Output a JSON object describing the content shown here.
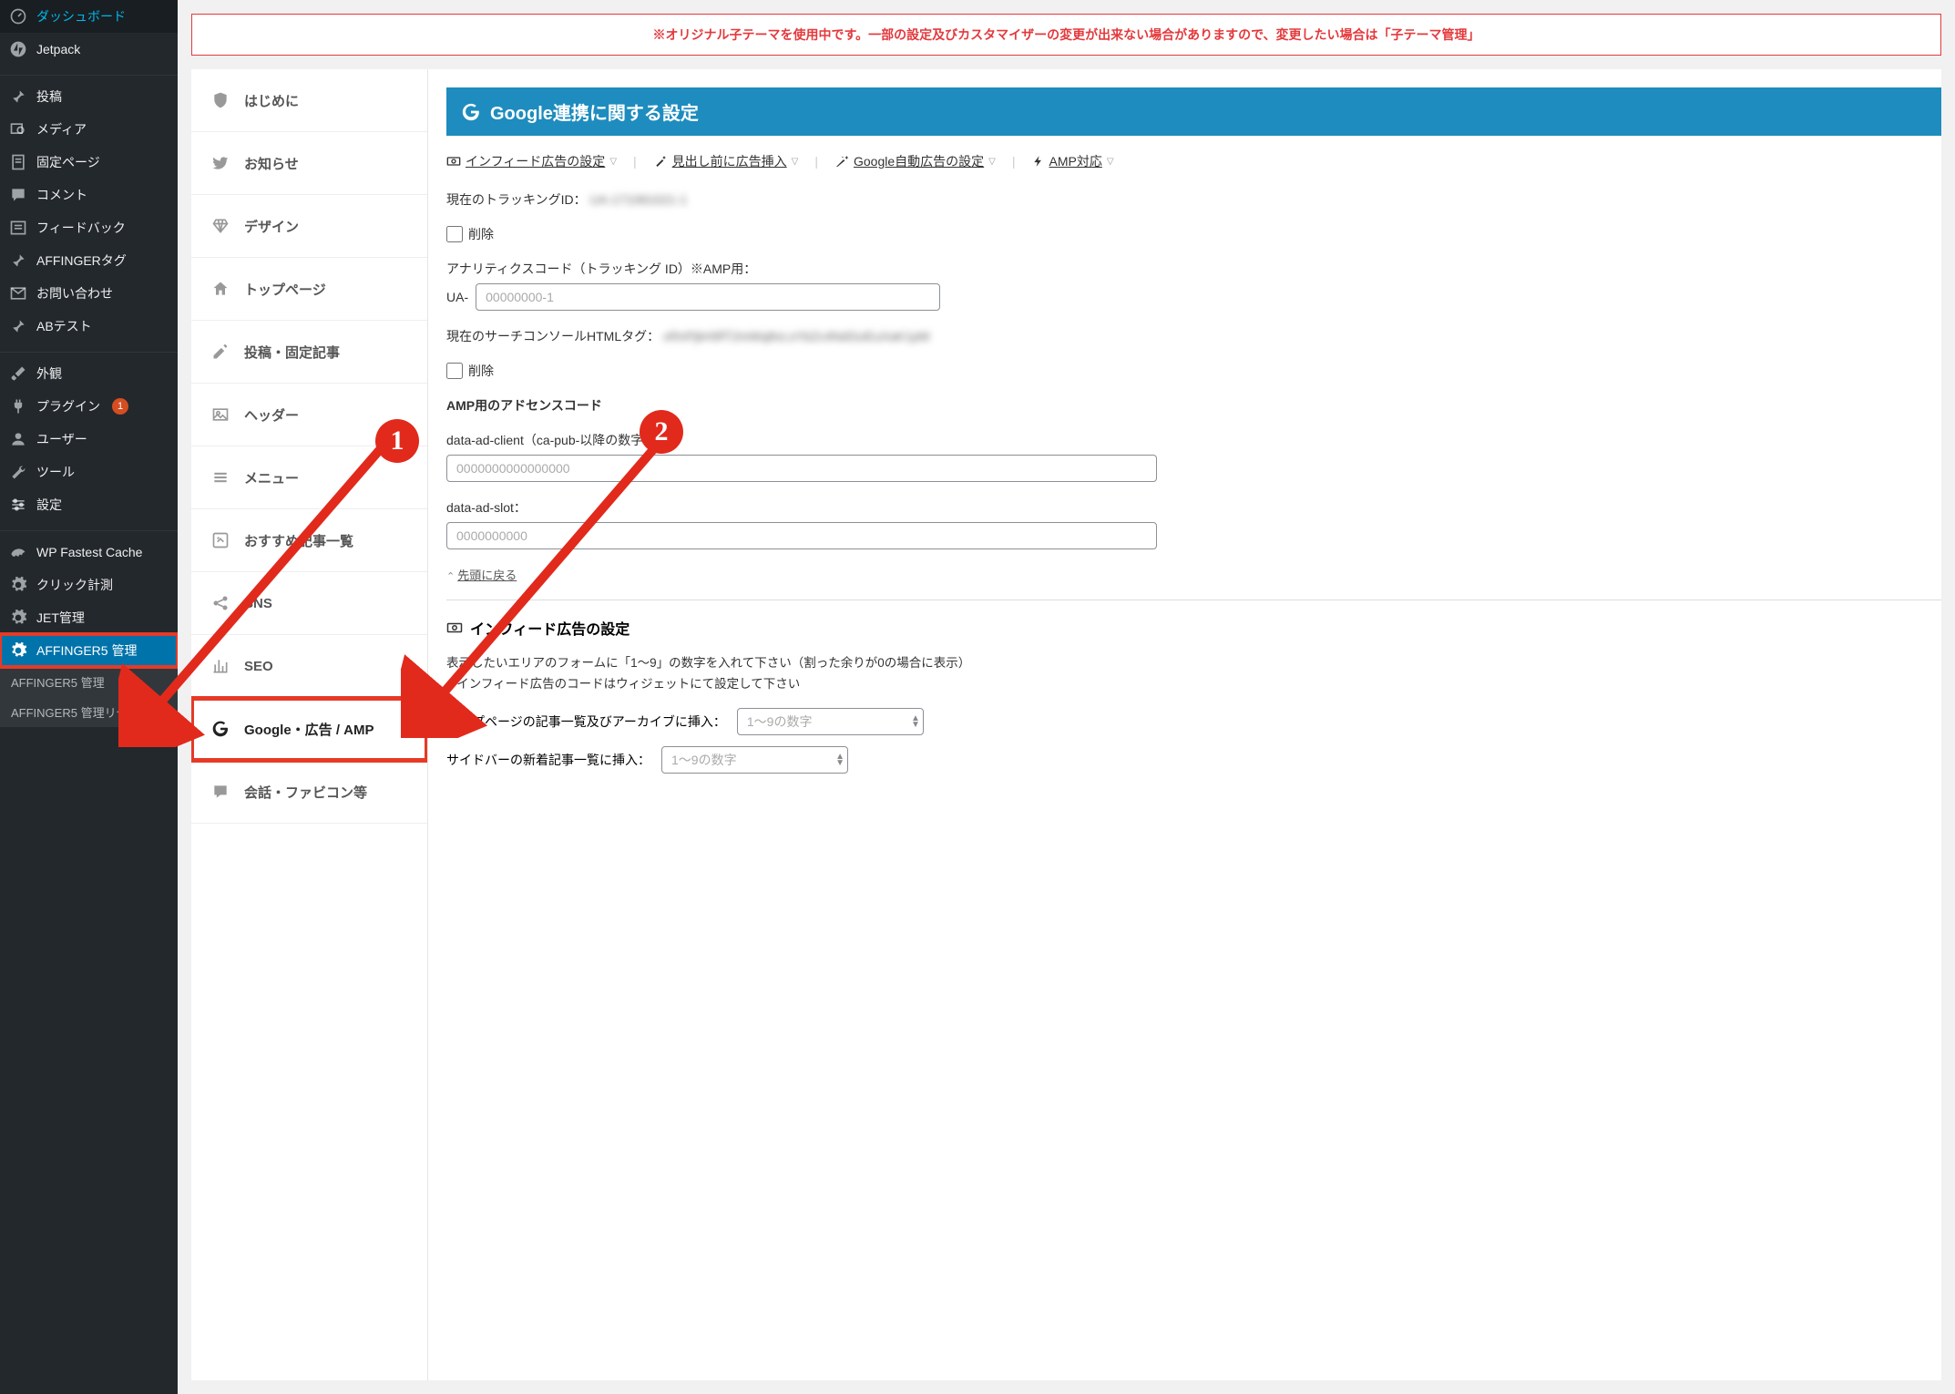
{
  "wp_sidebar": {
    "items": [
      {
        "label": "ダッシュボード",
        "icon": "dashboard"
      },
      {
        "label": "Jetpack",
        "icon": "jetpack"
      },
      {
        "sep": true
      },
      {
        "label": "投稿",
        "icon": "pin"
      },
      {
        "label": "メディア",
        "icon": "media"
      },
      {
        "label": "固定ページ",
        "icon": "page"
      },
      {
        "label": "コメント",
        "icon": "comment"
      },
      {
        "label": "フィードバック",
        "icon": "feedback"
      },
      {
        "label": "AFFINGERタグ",
        "icon": "pin"
      },
      {
        "label": "お問い合わせ",
        "icon": "mail"
      },
      {
        "label": "ABテスト",
        "icon": "pin"
      },
      {
        "sep": true
      },
      {
        "label": "外観",
        "icon": "brush"
      },
      {
        "label": "プラグイン",
        "icon": "plug",
        "badge": "1"
      },
      {
        "label": "ユーザー",
        "icon": "user"
      },
      {
        "label": "ツール",
        "icon": "wrench"
      },
      {
        "label": "設定",
        "icon": "sliders"
      },
      {
        "sep": true
      },
      {
        "label": "WP Fastest Cache",
        "icon": "cheetah"
      },
      {
        "label": "クリック計測",
        "icon": "gear"
      },
      {
        "label": "JET管理",
        "icon": "gear"
      },
      {
        "label": "AFFINGER5 管理",
        "icon": "gear",
        "active": true
      }
    ],
    "subs": [
      {
        "label": "AFFINGER5 管理"
      },
      {
        "label": "AFFINGER5 管理リセット"
      }
    ]
  },
  "warning": "※オリジナル子テーマを使用中です。一部の設定及びカスタマイザーの変更が出来ない場合がありますので、変更したい場合は「子テーマ管理」",
  "settings_nav": [
    {
      "label": "はじめに",
      "icon": "shield"
    },
    {
      "label": "お知らせ",
      "icon": "twitter"
    },
    {
      "label": "デザイン",
      "icon": "diamond"
    },
    {
      "label": "トップページ",
      "icon": "home"
    },
    {
      "label": "投稿・固定記事",
      "icon": "edit"
    },
    {
      "label": "ヘッダー",
      "icon": "image"
    },
    {
      "label": "メニュー",
      "icon": "menu"
    },
    {
      "label": "おすすめ記事一覧",
      "icon": "editbox"
    },
    {
      "label": "SNS",
      "icon": "share"
    },
    {
      "label": "SEO",
      "icon": "chart"
    },
    {
      "label": "Google・広告 / AMP",
      "icon": "google",
      "current": true
    },
    {
      "label": "会話・ファビコン等",
      "icon": "speech"
    }
  ],
  "main": {
    "header": "Google連携に関する設定",
    "quicklinks": [
      {
        "icon": "money",
        "text": "インフィード広告の設定"
      },
      {
        "icon": "wand",
        "text": "見出し前に広告挿入"
      },
      {
        "icon": "wand2",
        "text": "Google自動広告の設定"
      },
      {
        "icon": "bolt",
        "text": "AMP対応"
      }
    ],
    "tracking_label": "現在のトラッキングID：",
    "tracking_value": "UA-171061021-1",
    "delete_label": "削除",
    "analytics_label": "アナリティクスコード（トラッキング ID）※AMP用：",
    "ua_prefix": "UA-",
    "ua_placeholder": "00000000-1",
    "search_console_label": "現在のサーチコンソールHTMLタグ：",
    "search_console_value": "xRnPjkH9fT2mWq8vLsYbZc4NdGoEuXaK1pM",
    "delete2_label": "削除",
    "amp_adsense_title": "AMP用のアドセンスコード",
    "ad_client_label": "data-ad-client（ca-pub-以降の数字）：",
    "ad_client_placeholder": "0000000000000000",
    "ad_slot_label": "data-ad-slot：",
    "ad_slot_placeholder": "0000000000",
    "back_top": "先頭に戻る",
    "infeed_title": "インフィード広告の設定",
    "infeed_desc1": "表示したいエリアのフォームに「1〜9」の数字を入れて下さい（割った余りが0の場合に表示）",
    "infeed_desc2": "※インフィード広告のコードはウィジェットにて設定して下さい",
    "top_insert_label": "トップページの記事一覧及びアーカイブに挿入：",
    "num_placeholder": "1〜9の数字",
    "sidebar_insert_label": "サイドバーの新着記事一覧に挿入："
  },
  "annotations": {
    "n1": "1",
    "n2": "2"
  }
}
